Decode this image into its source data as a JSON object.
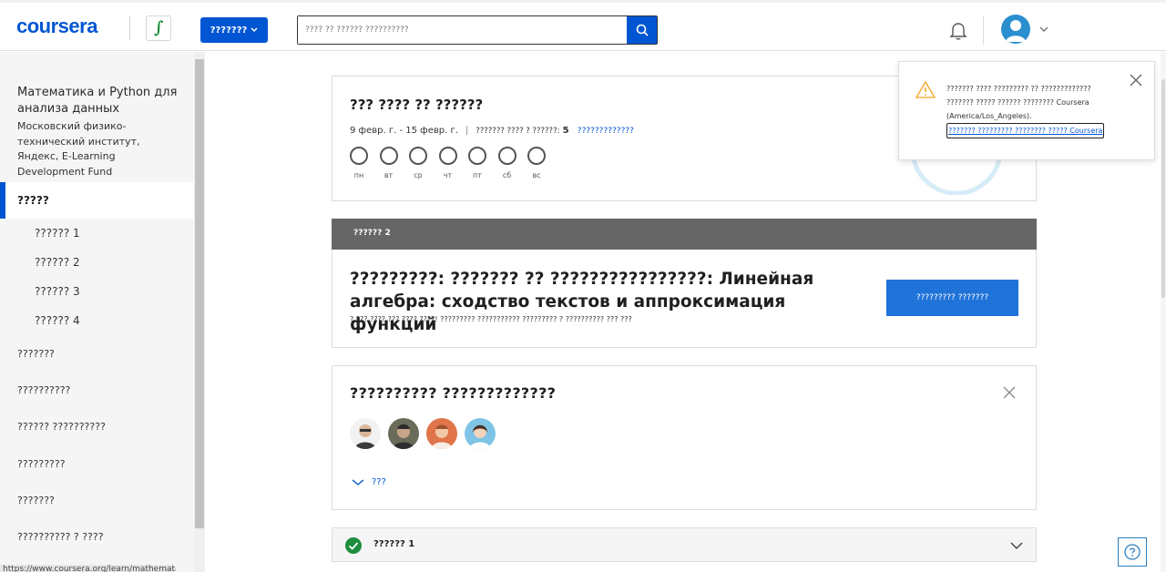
{
  "header": {
    "logo": "coursera",
    "explore_label": "???????",
    "search_placeholder": "???? ?? ?????? ??????????"
  },
  "sidebar": {
    "course_title": "Математика и Python для анализа данных",
    "course_org": "Московский физико-технический институт, Яндекс, E-Learning Development Fund",
    "active_item": "?????",
    "weeks": [
      "?????? 1",
      "?????? 2",
      "?????? 3",
      "?????? 4"
    ],
    "items": [
      "???????",
      "??????????",
      "?????? ??????????",
      "?????????",
      "???????",
      "?????????? ? ????"
    ],
    "url_tooltip": "https://www.coursera.org/learn/mathematics-and-python"
  },
  "schedule_card": {
    "title": "??? ???? ?? ??????",
    "dates": "9 февр. г. - 15 февр. г.",
    "goal_label": "??????? ???? ? ??????:",
    "goal_value": "5",
    "link": "?????????????",
    "days": [
      "пн",
      "вт",
      "ср",
      "чт",
      "пт",
      "сб",
      "вс"
    ]
  },
  "week_bar": {
    "label": "?????? 2"
  },
  "lesson_card": {
    "title": "?????????: ??????? ?? ????????????????: Линейная алгебра: сходство текстов и аппроксимация функций",
    "subtitle": "? ??? ???? ??? ???? ????! ????????? ??????????? ????????? ? ?????????? ??? ???",
    "resume_label": "????????? ???????"
  },
  "instructors_card": {
    "title": "?????????? ?????????????",
    "more_label": "???",
    "avatar_count": 4
  },
  "week1_card": {
    "label": "?????? 1"
  },
  "notification": {
    "text": "??????? ???? ????????? ?? ????????????? ??????? ????? ?????? ???????? Coursera (America/Los_Angeles).",
    "link": "??????? ????????? ???????? ????? Coursera"
  },
  "colors": {
    "brand": "#0056d2",
    "week_bar": "#666666",
    "success": "#1e8e3e",
    "warning": "#f5a623"
  }
}
